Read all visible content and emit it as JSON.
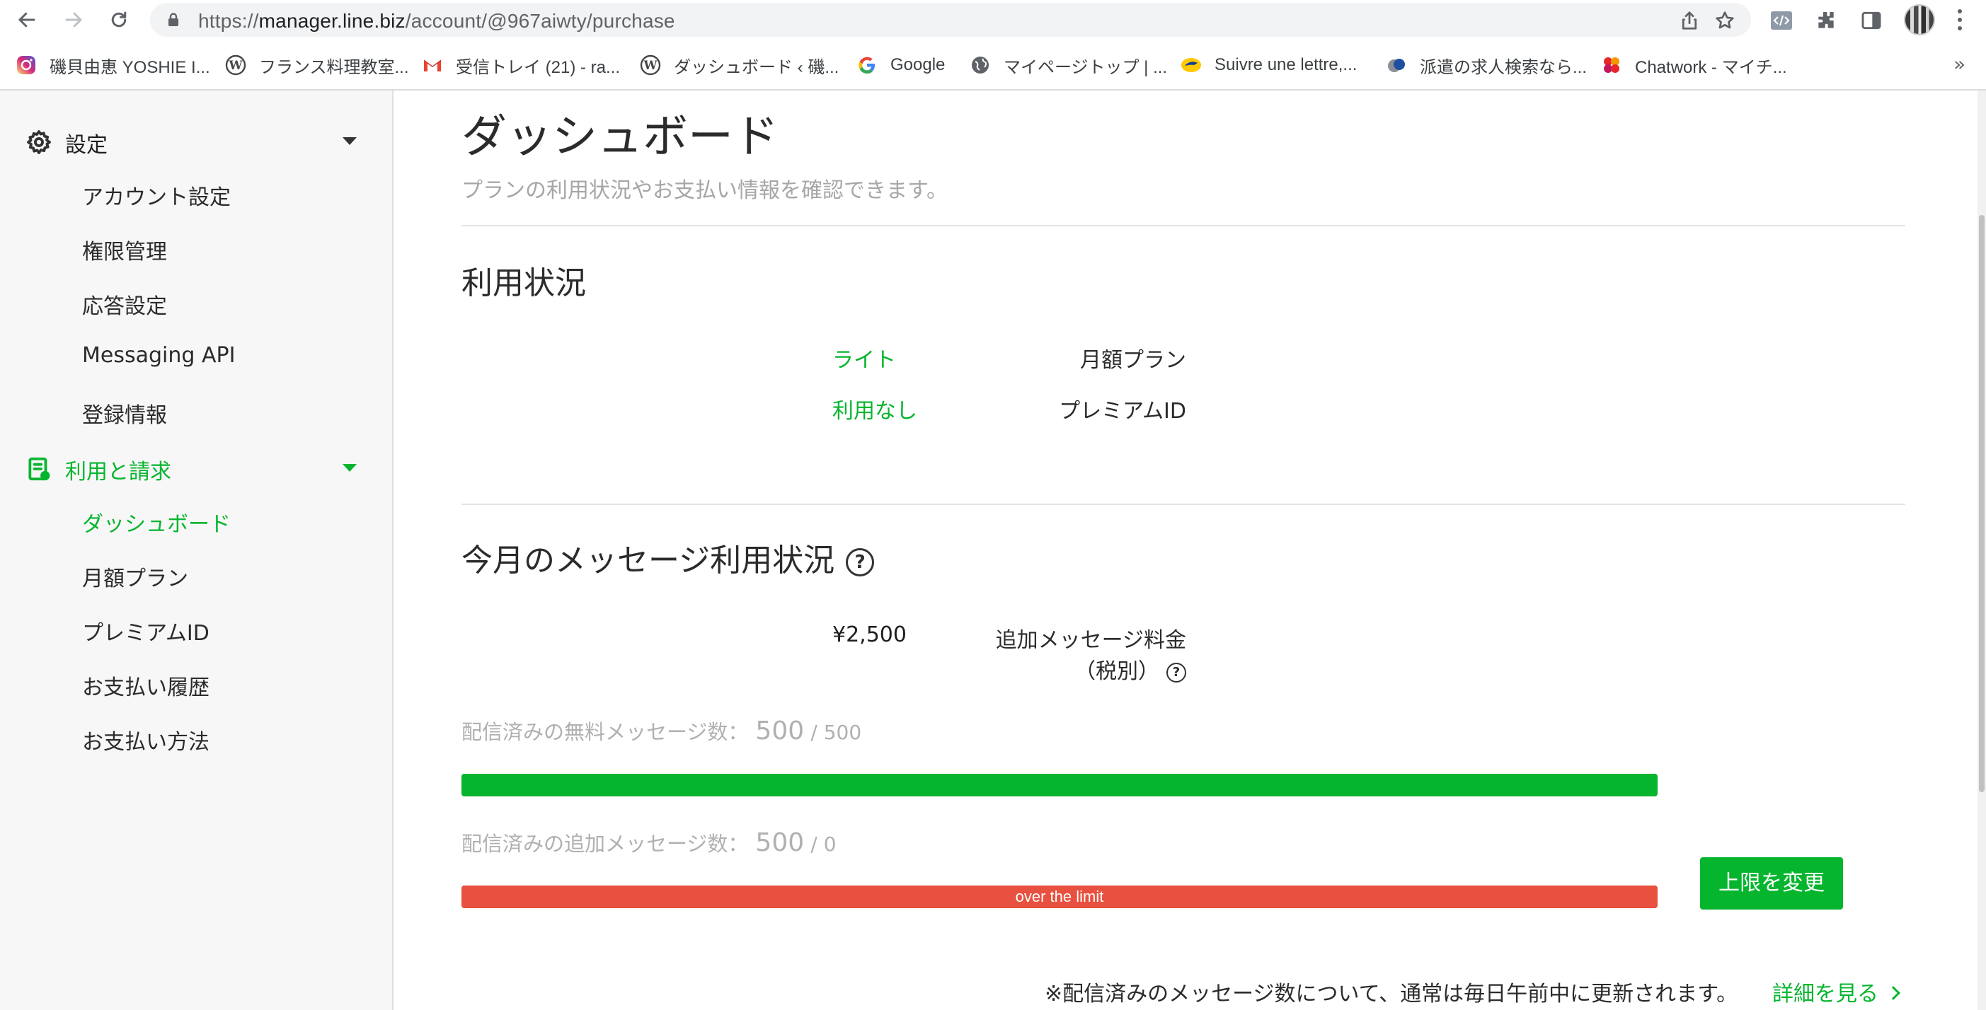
{
  "browser": {
    "url_scheme": "https://",
    "url_host": "manager.line.biz",
    "url_path": "/account/@967aiwty/purchase",
    "bookmarks": [
      {
        "label": "磯貝由恵 YOSHIE I...",
        "icon": "instagram-icon"
      },
      {
        "label": "フランス料理教室...",
        "icon": "wordpress-icon"
      },
      {
        "label": "受信トレイ (21) - ra...",
        "icon": "gmail-icon"
      },
      {
        "label": "ダッシュボード ‹ 磯...",
        "icon": "wordpress-icon"
      },
      {
        "label": "Google",
        "icon": "google-icon"
      },
      {
        "label": "マイページトップ | ...",
        "icon": "globe-icon"
      },
      {
        "label": "Suivre une lettre,...",
        "icon": "laposte-icon"
      },
      {
        "label": "派遣の求人検索なら...",
        "icon": "job-site-icon"
      },
      {
        "label": "Chatwork - マイチ...",
        "icon": "chatwork-icon"
      }
    ],
    "more_label": "»"
  },
  "sidebar": {
    "settings": {
      "label": "設定",
      "icon": "gear-icon",
      "items": [
        "アカウント設定",
        "権限管理",
        "応答設定",
        "Messaging API",
        "登録情報"
      ]
    },
    "billing": {
      "label": "利用と請求",
      "icon": "invoice-icon",
      "items": [
        "ダッシュボード",
        "月額プラン",
        "プレミアムID",
        "お支払い履歴",
        "お支払い方法"
      ],
      "active_index": 0
    }
  },
  "main": {
    "title": "ダッシュボード",
    "description": "プランの利用状況やお支払い情報を確認できます。",
    "usage": {
      "title": "利用状況",
      "rows": [
        {
          "label": "月額プラン",
          "value": "ライト"
        },
        {
          "label": "プレミアムID",
          "value": "利用なし"
        }
      ]
    },
    "messages": {
      "title": "今月のメッセージ利用状況",
      "help": "?",
      "extra_fee_label_line1": "追加メッセージ料金",
      "extra_fee_label_line2": "（税別）",
      "extra_fee_value": "¥2,500",
      "free": {
        "label": "配信済みの無料メッセージ数：",
        "count": "500",
        "limit": "/ 500",
        "fill_fraction": 1.0
      },
      "additional": {
        "label": "配信済みの追加メッセージ数：",
        "count": "500",
        "limit": "/ 0",
        "fill_fraction": 1.0,
        "bar_text": "over the limit"
      },
      "change_limit_button": "上限を変更",
      "note": "※配信済みのメッセージ数について、通常は毎日午前中に更新されます。",
      "detail_link": "詳細を見る"
    }
  },
  "colors": {
    "brand_green": "#06b52e",
    "over_limit_red": "#e8503f"
  }
}
